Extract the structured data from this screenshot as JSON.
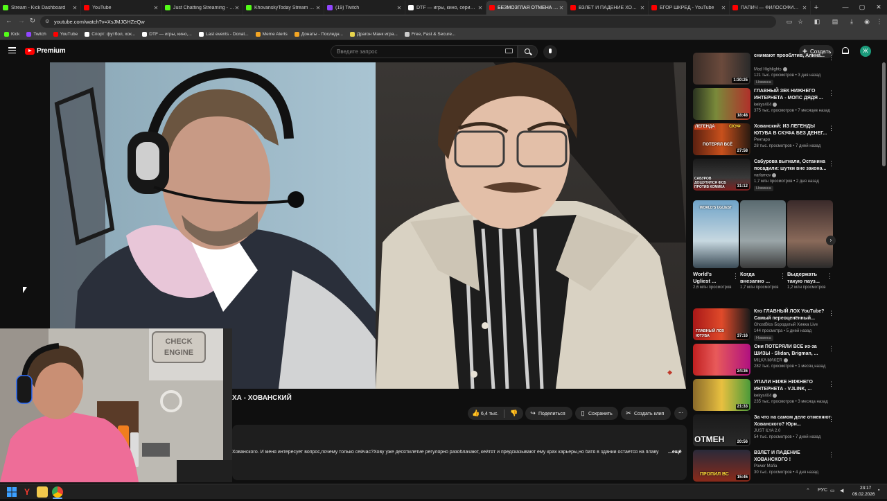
{
  "browser": {
    "tabs": [
      {
        "title": "Stream - Kick Dashboard",
        "color": "#53fc18"
      },
      {
        "title": "YouTube",
        "color": "#ff0000"
      },
      {
        "title": "Just Chatting Streaming - Live",
        "color": "#53fc18"
      },
      {
        "title": "KhovanskyToday Stream - Watch",
        "color": "#53fc18"
      },
      {
        "title": "(19) Twitch",
        "color": "#9146ff"
      },
      {
        "title": "DTF — игры, кино, сериалы",
        "color": "#ffffff"
      },
      {
        "title": "БЕЗМОЗГЛАЯ ОТМЕНА ХОВАНСКОГО",
        "color": "#ff0000"
      },
      {
        "title": "ВЗЛЕТ И ПАДЕНИЕ ХОВАНСКОГО",
        "color": "#ff0000"
      },
      {
        "title": "ЕГОР ШКРЕД - YouTube",
        "color": "#ff0000"
      },
      {
        "title": "ПАПИЧ — ФИЛОСОФИЯ СВОБОДЫ",
        "color": "#ff0000"
      }
    ],
    "active_tab": 6,
    "url": "youtube.com/watch?v=XsJMJGHZeQw",
    "bookmarks": [
      {
        "label": "Kick",
        "color": "#53fc18"
      },
      {
        "label": "Twitch",
        "color": "#9146ff"
      },
      {
        "label": "YouTube",
        "color": "#ff0000"
      },
      {
        "label": "Спорт: футбол, хок...",
        "color": "#ffffff"
      },
      {
        "label": "DTF — игры, кино,...",
        "color": "#ffffff"
      },
      {
        "label": "Last events - Donat...",
        "color": "#ffffff"
      },
      {
        "label": "Meme Alerts",
        "color": "#f5a623"
      },
      {
        "label": "Донаты - Последн...",
        "color": "#f5a623"
      },
      {
        "label": "Драгон Манк игра...",
        "color": "#e8d44d"
      },
      {
        "label": "Free, Fast & Secure...",
        "color": "#cccccc"
      }
    ]
  },
  "youtube": {
    "logo_text": "Premium",
    "search_placeholder": "Введите запрос",
    "create_label": "Создать",
    "avatar_letter": "Ж",
    "accent": "#ff0000"
  },
  "video": {
    "title_visible": "ХА - ХОВАНСКИЙ",
    "likes": "6,4 тыс.",
    "share_label": "Поделиться",
    "save_label": "Сохранить",
    "clip_label": "Создать клип",
    "description": "Хованского. И меня интересует вопрос,почему только сейчас?Хову уже десятилетие регулярно разоблачают, кейтят и предсказывают ему крах карьеры,но батя в здании остается на плаву",
    "more_label": "...ещё"
  },
  "sidebar": {
    "videos_top": [
      {
        "title": "снимают прооблтив, Алина...",
        "channel": "Mad Highlights",
        "meta": "121 тыс. просмотров • 3 дня назад",
        "badge": "Новинка",
        "duration": "1:30:25",
        "verified": true
      },
      {
        "title": "ГЛАВНЫЙ ЗЕК НИЖНЕГО ИНТЕРНЕТА - МОПС ДЯДЯ ...",
        "channel": "kekys404",
        "meta": "375 тыс. просмотров • 7 месяцев назад",
        "badge": "",
        "duration": "18:48",
        "verified": true
      },
      {
        "title": "Хованский: ИЗ ЛЕГЕНДЫ ЮТУБА В СКУФА БЕЗ ДЕНЕГ...",
        "channel": "Рентаро",
        "meta": "28 тыс. просмотров • 7 дней назад",
        "badge": "",
        "duration": "27:58",
        "verified": false
      },
      {
        "title": "Сабурова выгнали, Останина посадили: шутки вне закона...",
        "channel": "varlamov",
        "meta": "1,7 млн просмотров • 2 дня назад",
        "badge": "Новинка",
        "duration": "31:12",
        "verified": true
      }
    ],
    "shorts": [
      {
        "title": "World's Ugliest ...",
        "views": "2,6 млн просмотров"
      },
      {
        "title": "Когда внезапно ...",
        "views": "1,7 млн просмотров"
      },
      {
        "title": "Выдержать такую пауз...",
        "views": "1,2 млн просмотров"
      }
    ],
    "videos_bottom": [
      {
        "title": "Кто ГЛАВНЫЙ ЛОХ YouTube? Самый переоценённый...",
        "channel": "GhostBlos Бородатый Хижка Live",
        "meta": "144 просмотра • 5 дней назад",
        "badge": "Новинка",
        "duration": "37:16",
        "verified": false
      },
      {
        "title": "Они ПОТЕРЯЛИ ВСЕ из-за ШИЗЫ - Slidan, Brigman, ...",
        "channel": "MILKA MAKER",
        "meta": "282 тыс. просмотров • 1 месяц назад",
        "badge": "",
        "duration": "24:36",
        "verified": true
      },
      {
        "title": "УПАЛИ НИЖЕ НИЖНЕГО ИНТЕРНЕТА - VJLINK, ...",
        "channel": "kekys404",
        "meta": "235 тыс. просмотров • 3 месяца назад",
        "badge": "",
        "duration": "21:33",
        "verified": true
      },
      {
        "title": "За что на самом деле отменяют Хованского? Юри...",
        "channel": "JUST ILYA 2.0",
        "meta": "54 тыс. просмотров • 7 дней назад",
        "badge": "",
        "duration": "20:56",
        "verified": false
      },
      {
        "title": "ВЗЛЕТ И ПАДЕНИЕ ХОВАНСКОГО !",
        "channel": "Power Mafia",
        "meta": "30 тыс. просмотров • 4 дня назад",
        "badge": "",
        "duration": "15:45",
        "verified": false
      }
    ],
    "thumb_texts": {
      "t2a": "ЛЕГЕНДА",
      "t2b": "СКУФ",
      "t2c": "ПОТЕРЯЛ ВСЁ",
      "t3": "САБУРОВ ДОШУТИЛСЯ ФСБ ПРОТИВ КОМИКА",
      "s1": "WORLD'S UGLIEST",
      "b1": "ГЛАВНЫЙ ЛОХ ЮТУБА",
      "b4": "ОТМЕН",
      "b5": "ПРОПИЛ ВС"
    }
  },
  "overlay": {
    "sign_text": "CHECK ENGINE"
  },
  "taskbar": {
    "lang": "РУС",
    "time": "23:17",
    "date": "09.02.2026"
  }
}
